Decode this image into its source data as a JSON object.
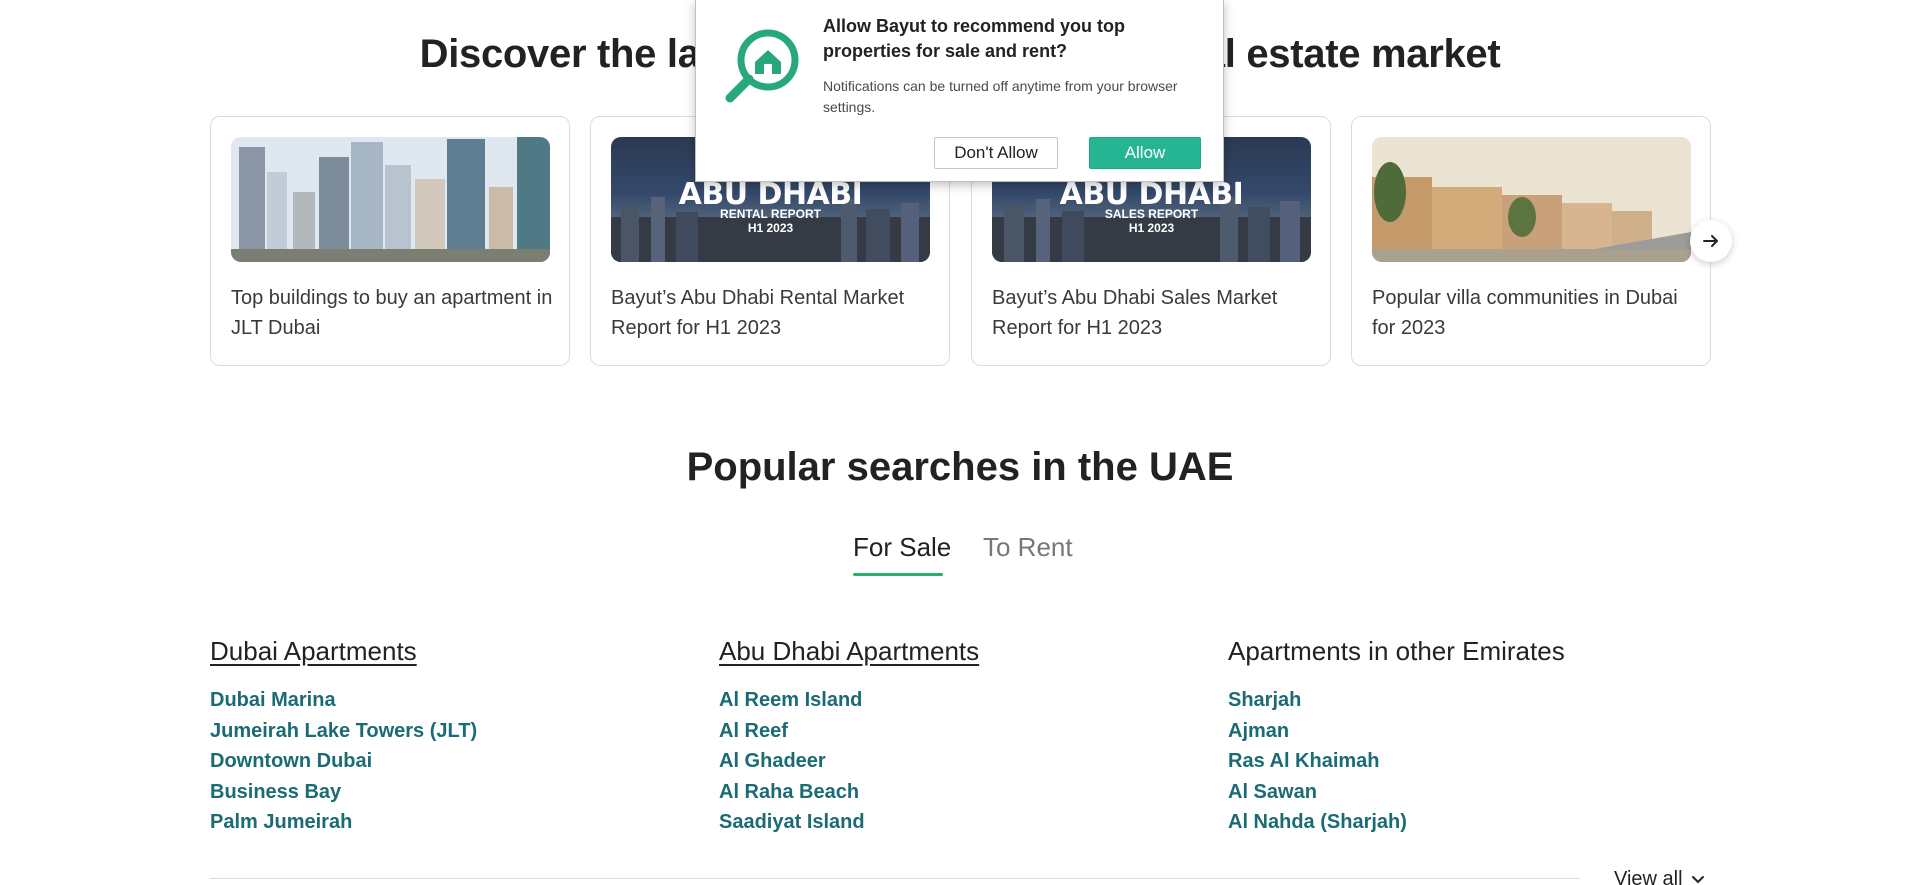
{
  "discover": {
    "title": "Discover the latest insights on the UAE real estate market"
  },
  "cards": [
    {
      "text": "Top buildings to buy an apartment in JLT Dubai",
      "image": "jlt-towers-photo"
    },
    {
      "text": "Bayut’s Abu Dhabi Rental Market Report for H1 2023",
      "image": "abu-dhabi-skyline",
      "overlay_title": "ABU DHABI",
      "overlay_sub1": "RENTAL REPORT",
      "overlay_sub2": "H1 2023"
    },
    {
      "text": "Bayut’s Abu Dhabi Sales Market Report for H1 2023",
      "image": "abu-dhabi-skyline",
      "overlay_title": "ABU DHABI",
      "overlay_sub1": "SALES REPORT",
      "overlay_sub2": "H1 2023"
    },
    {
      "text": "Popular villa communities in Dubai for 2023",
      "image": "villa-street-photo"
    }
  ],
  "carousel": {
    "next_icon": "arrow-right-icon"
  },
  "popular": {
    "title": "Popular searches in the UAE",
    "tabs": [
      {
        "label": "For Sale",
        "active": true
      },
      {
        "label": "To Rent",
        "active": false
      }
    ],
    "columns": [
      {
        "heading": "Dubai Apartments",
        "items": [
          "Dubai Marina",
          "Jumeirah Lake Towers (JLT)",
          "Downtown Dubai",
          "Business Bay",
          "Palm Jumeirah"
        ]
      },
      {
        "heading": "Abu Dhabi Apartments",
        "items": [
          "Al Reem Island",
          "Al Reef",
          "Al Ghadeer",
          "Al Raha Beach",
          "Saadiyat Island"
        ]
      },
      {
        "heading": "Apartments in other Emirates",
        "items": [
          "Sharjah",
          "Ajman",
          "Ras Al Khaimah",
          "Al Sawan",
          "Al Nahda (Sharjah)"
        ]
      }
    ],
    "view_all": "View all"
  },
  "notification": {
    "title": "Allow Bayut to recommend you top properties for sale and rent?",
    "body": "Notifications can be turned off anytime from your browser settings.",
    "deny_label": "Don't Allow",
    "allow_label": "Allow",
    "icon": "house-search-icon"
  },
  "colors": {
    "accent": "#28b16d",
    "link": "#1b6b74",
    "allow_button": "#25b592"
  }
}
